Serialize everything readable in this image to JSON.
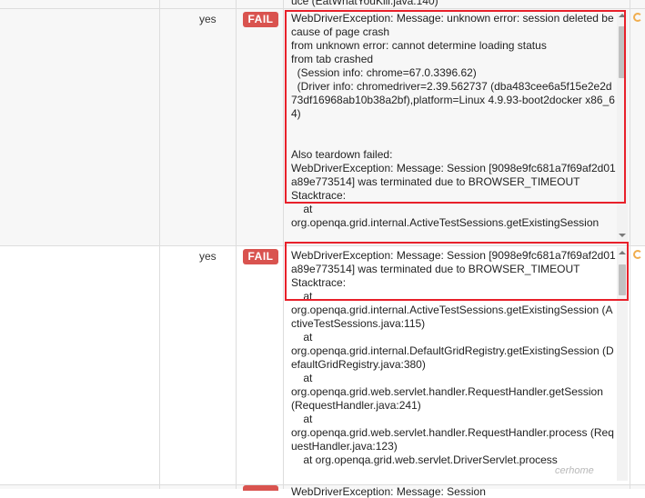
{
  "rows": [
    {
      "status": "yes",
      "badge": "FAIL",
      "prev_stack_tail": "uce (EatWhatYouKill.java:140)",
      "message": "WebDriverException: Message: unknown error: session deleted because of page crash\nfrom unknown error: cannot determine loading status\nfrom tab crashed\n  (Session info: chrome=67.0.3396.62)\n  (Driver info: chromedriver=2.39.562737 (dba483cee6a5f15e2e2d73df16968ab10b38a2bf),platform=Linux 4.9.93-boot2docker x86_64)\n\n\nAlso teardown failed:\nWebDriverException: Message: Session [9098e9fc681a7f69af2d01a89e773514] was terminated due to BROWSER_TIMEOUT\nStacktrace:\n    at\norg.openqa.grid.internal.ActiveTestSessions.getExistingSession"
    },
    {
      "status": "yes",
      "badge": "FAIL",
      "message": "WebDriverException: Message: Session [9098e9fc681a7f69af2d01a89e773514] was terminated due to BROWSER_TIMEOUT\nStacktrace:\n    at\norg.openqa.grid.internal.ActiveTestSessions.getExistingSession (ActiveTestSessions.java:115)\n    at\norg.openqa.grid.internal.DefaultGridRegistry.getExistingSession (DefaultGridRegistry.java:380)\n    at\norg.openqa.grid.web.servlet.handler.RequestHandler.getSession (RequestHandler.java:241)\n    at\norg.openqa.grid.web.servlet.handler.RequestHandler.process (RequestHandler.java:123)\n    at org.openqa.grid.web.servlet.DriverServlet.process"
    },
    {
      "next_partial": "WebDriverException: Message: Session"
    }
  ],
  "watermark": "cerhome",
  "colors": {
    "fail": "#d9534f",
    "highlight": "#e8202a",
    "row_alt": "#f7f7f7",
    "border": "#dddddd"
  },
  "icons": {
    "spinner": "loading-spinner-icon"
  }
}
